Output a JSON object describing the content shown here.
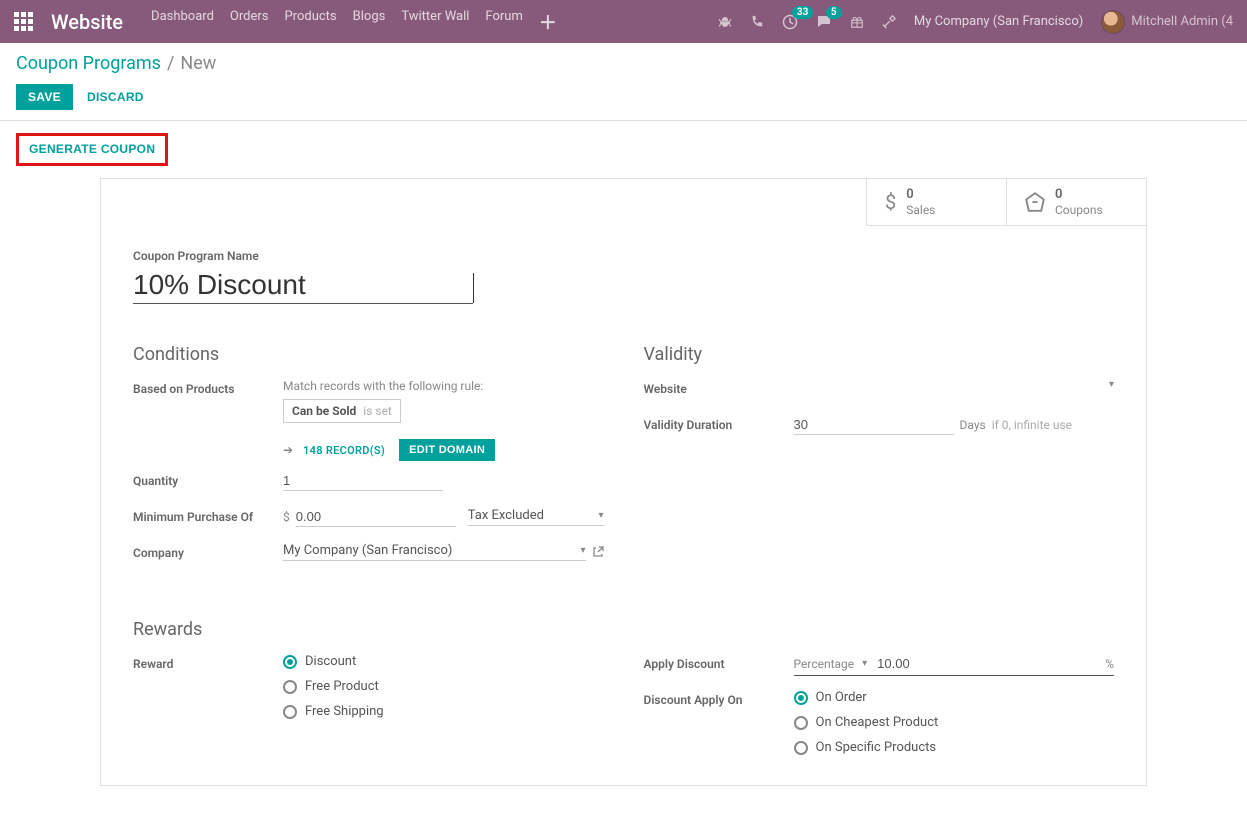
{
  "navbar": {
    "brand": "Website",
    "items": [
      "Dashboard",
      "Orders",
      "Products",
      "Blogs",
      "Twitter Wall",
      "Forum"
    ],
    "badge_activities": "33",
    "badge_messages": "5",
    "company": "My Company (San Francisco)",
    "user": "Mitchell Admin (4"
  },
  "breadcrumb": {
    "root": "Coupon Programs",
    "current": "New"
  },
  "buttons": {
    "save": "SAVE",
    "discard": "DISCARD",
    "generate": "GENERATE COUPON"
  },
  "stats": {
    "sales": {
      "value": "0",
      "label": "Sales"
    },
    "coupons": {
      "value": "0",
      "label": "Coupons"
    }
  },
  "form": {
    "name_label": "Coupon Program Name",
    "name_value": "10% Discount",
    "conditions": {
      "title": "Conditions",
      "based_on_label": "Based on Products",
      "match_rule_text": "Match records with the following rule:",
      "domain_chip_field": "Can be Sold",
      "domain_chip_suffix": "is set",
      "records_link": "148 RECORD(S)",
      "edit_domain": "EDIT DOMAIN",
      "quantity_label": "Quantity",
      "quantity_value": "1",
      "min_purchase_label": "Minimum Purchase Of",
      "min_purchase_currency": "$",
      "min_purchase_value": "0.00",
      "tax_option": "Tax Excluded",
      "company_label": "Company",
      "company_value": "My Company (San Francisco)"
    },
    "validity": {
      "title": "Validity",
      "website_label": "Website",
      "duration_label": "Validity Duration",
      "duration_value": "30",
      "duration_unit": "Days",
      "duration_hint": "if 0, infinite use"
    },
    "rewards": {
      "title": "Rewards",
      "reward_label": "Reward",
      "reward_options": [
        "Discount",
        "Free Product",
        "Free Shipping"
      ],
      "apply_discount_label": "Apply Discount",
      "apply_discount_type": "Percentage",
      "apply_discount_value": "10.00",
      "apply_discount_unit": "%",
      "discount_apply_on_label": "Discount Apply On",
      "discount_apply_on_options": [
        "On Order",
        "On Cheapest Product",
        "On Specific Products"
      ]
    }
  }
}
